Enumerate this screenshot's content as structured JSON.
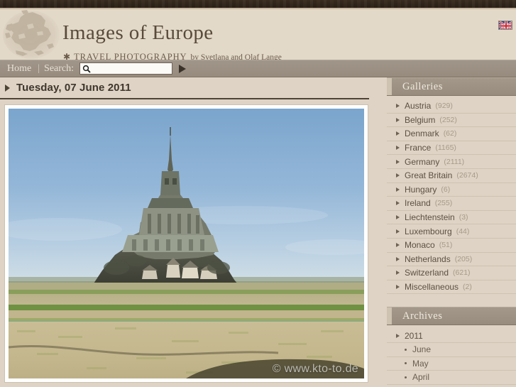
{
  "site": {
    "title": "Images of Europe",
    "subtitle_star": "✱",
    "subtitle_caps": "TRAVEL PHOTOGRAPHY",
    "subtitle_by": "by Svetlana and Olaf Lange",
    "logo_icon": "europe-map-icon",
    "flag_icon": "union-jack-flag-icon"
  },
  "nav": {
    "home_label": "Home",
    "separator": "|",
    "search_label": "Search:",
    "search_value": "",
    "search_placeholder": "",
    "search_icon": "magnifier-icon",
    "go_icon": "play-triangle-icon"
  },
  "post": {
    "date": "Tuesday, 07 June 2011",
    "photo_alt": "Mont Saint-Michel abbey across tidal flats",
    "watermark": "© www.kto-to.de"
  },
  "sidebar": {
    "galleries": {
      "title": "Galleries",
      "items": [
        {
          "label": "Austria",
          "count": "(929)"
        },
        {
          "label": "Belgium",
          "count": "(252)"
        },
        {
          "label": "Denmark",
          "count": "(62)"
        },
        {
          "label": "France",
          "count": "(1165)"
        },
        {
          "label": "Germany",
          "count": "(2111)"
        },
        {
          "label": "Great Britain",
          "count": "(2674)"
        },
        {
          "label": "Hungary",
          "count": "(6)"
        },
        {
          "label": "Ireland",
          "count": "(255)"
        },
        {
          "label": "Liechtenstein",
          "count": "(3)"
        },
        {
          "label": "Luxembourg",
          "count": "(44)"
        },
        {
          "label": "Monaco",
          "count": "(51)"
        },
        {
          "label": "Netherlands",
          "count": "(205)"
        },
        {
          "label": "Switzerland",
          "count": "(621)"
        },
        {
          "label": "Miscellaneous",
          "count": "(2)"
        }
      ]
    },
    "archives": {
      "title": "Archives",
      "items": [
        {
          "label": "2011",
          "level": "year"
        },
        {
          "label": "June",
          "level": "month"
        },
        {
          "label": "May",
          "level": "month"
        },
        {
          "label": "April",
          "level": "month"
        }
      ]
    }
  },
  "colors": {
    "page_bg": "#ded3c4",
    "header_bg": "#e3d9c9",
    "navbar_bg": "#9a8f82",
    "top_band": "#31251a",
    "text": "#5c5043",
    "muted": "#a79b8b"
  }
}
